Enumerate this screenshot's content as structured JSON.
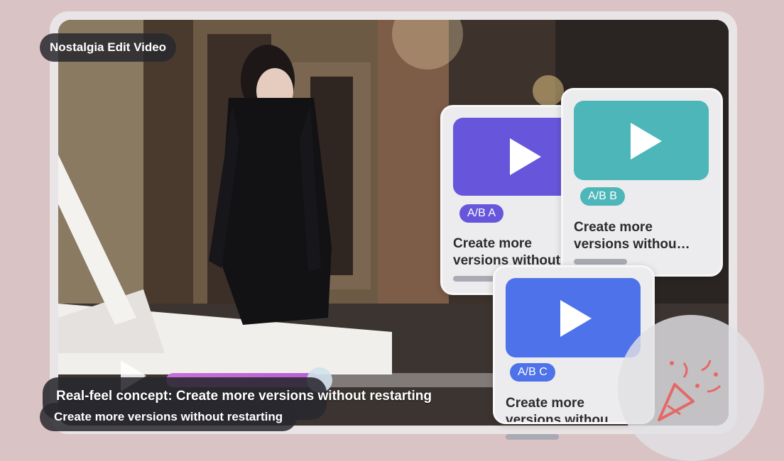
{
  "title": "Nostalgia Edit Video",
  "caption": "Real-feel concept: Create more versions without restarting",
  "subtitle": "Create more versions without restarting",
  "cards": [
    {
      "badge": "A/B A",
      "text_line1": "Create more",
      "text_line2": "versions without",
      "thumb_color": "#6756dc",
      "badge_color": "#6756dc"
    },
    {
      "badge": "A/B B",
      "text_line1": "Create more",
      "text_line2": "versions withou…",
      "thumb_color": "#4db6b8",
      "badge_color": "#4db6b8"
    },
    {
      "badge": "A/B C",
      "text_line1": "Create more",
      "text_line2": "versions withou…",
      "thumb_color": "#4e72ea",
      "badge_color": "#4e72ea"
    }
  ],
  "icons": {
    "play": "play-icon",
    "celebrate": "party-popper-icon"
  }
}
